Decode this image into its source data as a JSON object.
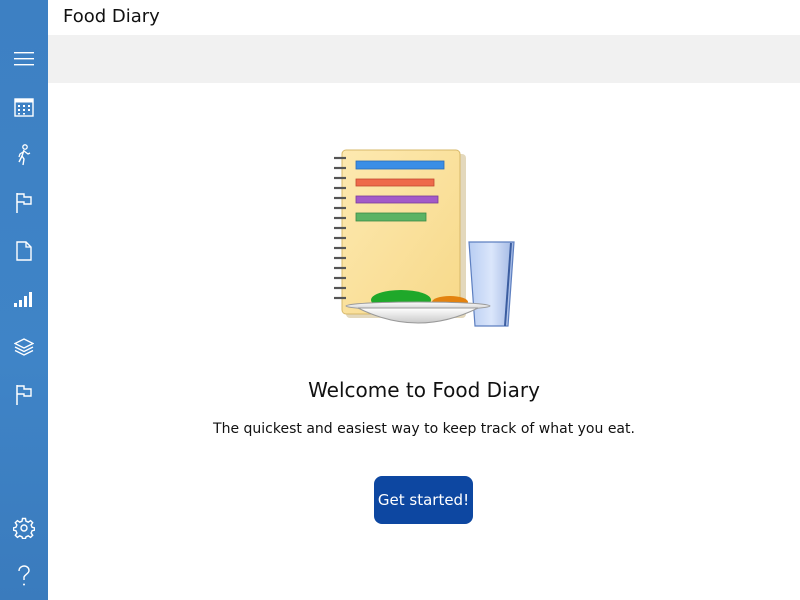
{
  "app": {
    "title": "Food Diary"
  },
  "nav": {
    "items": [
      {
        "icon": "hamburger-menu-icon"
      },
      {
        "icon": "calendar-icon"
      },
      {
        "icon": "walking-person-icon"
      },
      {
        "icon": "flag-icon"
      },
      {
        "icon": "document-icon"
      },
      {
        "icon": "signal-bars-icon"
      },
      {
        "icon": "layers-icon"
      },
      {
        "icon": "flag-icon"
      }
    ],
    "bottom_items": [
      {
        "icon": "gear-icon"
      },
      {
        "icon": "question-mark-icon"
      }
    ],
    "color": "#3d80c3"
  },
  "welcome": {
    "title": "Welcome to Food Diary",
    "subtitle": "The quickest and easiest way to keep track of what you eat.",
    "button_label": "Get started!",
    "button_color": "#0d47a1"
  }
}
